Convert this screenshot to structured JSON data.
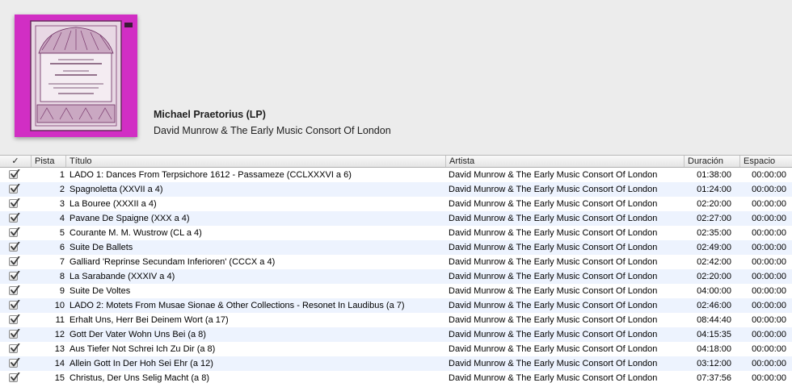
{
  "album": {
    "title": "Michael Praetorius (LP)",
    "artist": "David Munrow & The Early Music Consort Of London",
    "cover_color": "#d12ec4"
  },
  "columns": {
    "check": "✓",
    "track": "Pista",
    "title": "Título",
    "artist": "Artista",
    "duration": "Duración",
    "space": "Espacio"
  },
  "tracks": [
    {
      "num": "1",
      "title": "LADO 1: Dances From Terpsichore 1612 - Passameze (CCLXXXVI a 6)",
      "artist": "David Munrow & The Early Music Consort Of London",
      "duration": "01:38:00",
      "space": "00:00:00"
    },
    {
      "num": "2",
      "title": "Spagnoletta (XXVII a 4)",
      "artist": "David Munrow & The Early Music Consort Of London",
      "duration": "01:24:00",
      "space": "00:00:00"
    },
    {
      "num": "3",
      "title": "La Bouree (XXXII a 4)",
      "artist": "David Munrow & The Early Music Consort Of London",
      "duration": "02:20:00",
      "space": "00:00:00"
    },
    {
      "num": "4",
      "title": "Pavane De Spaigne (XXX a 4)",
      "artist": "David Munrow & The Early Music Consort Of London",
      "duration": "02:27:00",
      "space": "00:00:00"
    },
    {
      "num": "5",
      "title": "Courante M. M. Wustrow (CL a 4)",
      "artist": "David Munrow & The Early Music Consort Of London",
      "duration": "02:35:00",
      "space": "00:00:00"
    },
    {
      "num": "6",
      "title": "Suite De Ballets",
      "artist": "David Munrow & The Early Music Consort Of London",
      "duration": "02:49:00",
      "space": "00:00:00"
    },
    {
      "num": "7",
      "title": "Galliard 'Reprinse Secundam Inferioren' (CCCX a 4)",
      "artist": "David Munrow & The Early Music Consort Of London",
      "duration": "02:42:00",
      "space": "00:00:00"
    },
    {
      "num": "8",
      "title": "La Sarabande (XXXIV a 4)",
      "artist": "David Munrow & The Early Music Consort Of London",
      "duration": "02:20:00",
      "space": "00:00:00"
    },
    {
      "num": "9",
      "title": "Suite De Voltes",
      "artist": "David Munrow & The Early Music Consort Of London",
      "duration": "04:00:00",
      "space": "00:00:00"
    },
    {
      "num": "10",
      "title": "LADO 2: Motets From Musae Sionae & Other Collections - Resonet In Laudibus (a 7)",
      "artist": "David Munrow & The Early Music Consort Of London",
      "duration": "02:46:00",
      "space": "00:00:00"
    },
    {
      "num": "11",
      "title": "Erhalt Uns, Herr Bei Deinem Wort (a 17)",
      "artist": "David Munrow & The Early Music Consort Of London",
      "duration": "08:44:40",
      "space": "00:00:00"
    },
    {
      "num": "12",
      "title": "Gott Der Vater Wohn Uns Bei (a 8)",
      "artist": "David Munrow & The Early Music Consort Of London",
      "duration": "04:15:35",
      "space": "00:00:00"
    },
    {
      "num": "13",
      "title": "Aus Tiefer Not Schrei Ich Zu Dir (a 8)",
      "artist": "David Munrow & The Early Music Consort Of London",
      "duration": "04:18:00",
      "space": "00:00:00"
    },
    {
      "num": "14",
      "title": "Allein Gott In Der Hoh Sei Ehr (a 12)",
      "artist": "David Munrow & The Early Music Consort Of London",
      "duration": "03:12:00",
      "space": "00:00:00"
    },
    {
      "num": "15",
      "title": "Christus, Der Uns Selig Macht (a 8)",
      "artist": "David Munrow & The Early Music Consort Of London",
      "duration": "07:37:56",
      "space": "00:00:00"
    }
  ]
}
